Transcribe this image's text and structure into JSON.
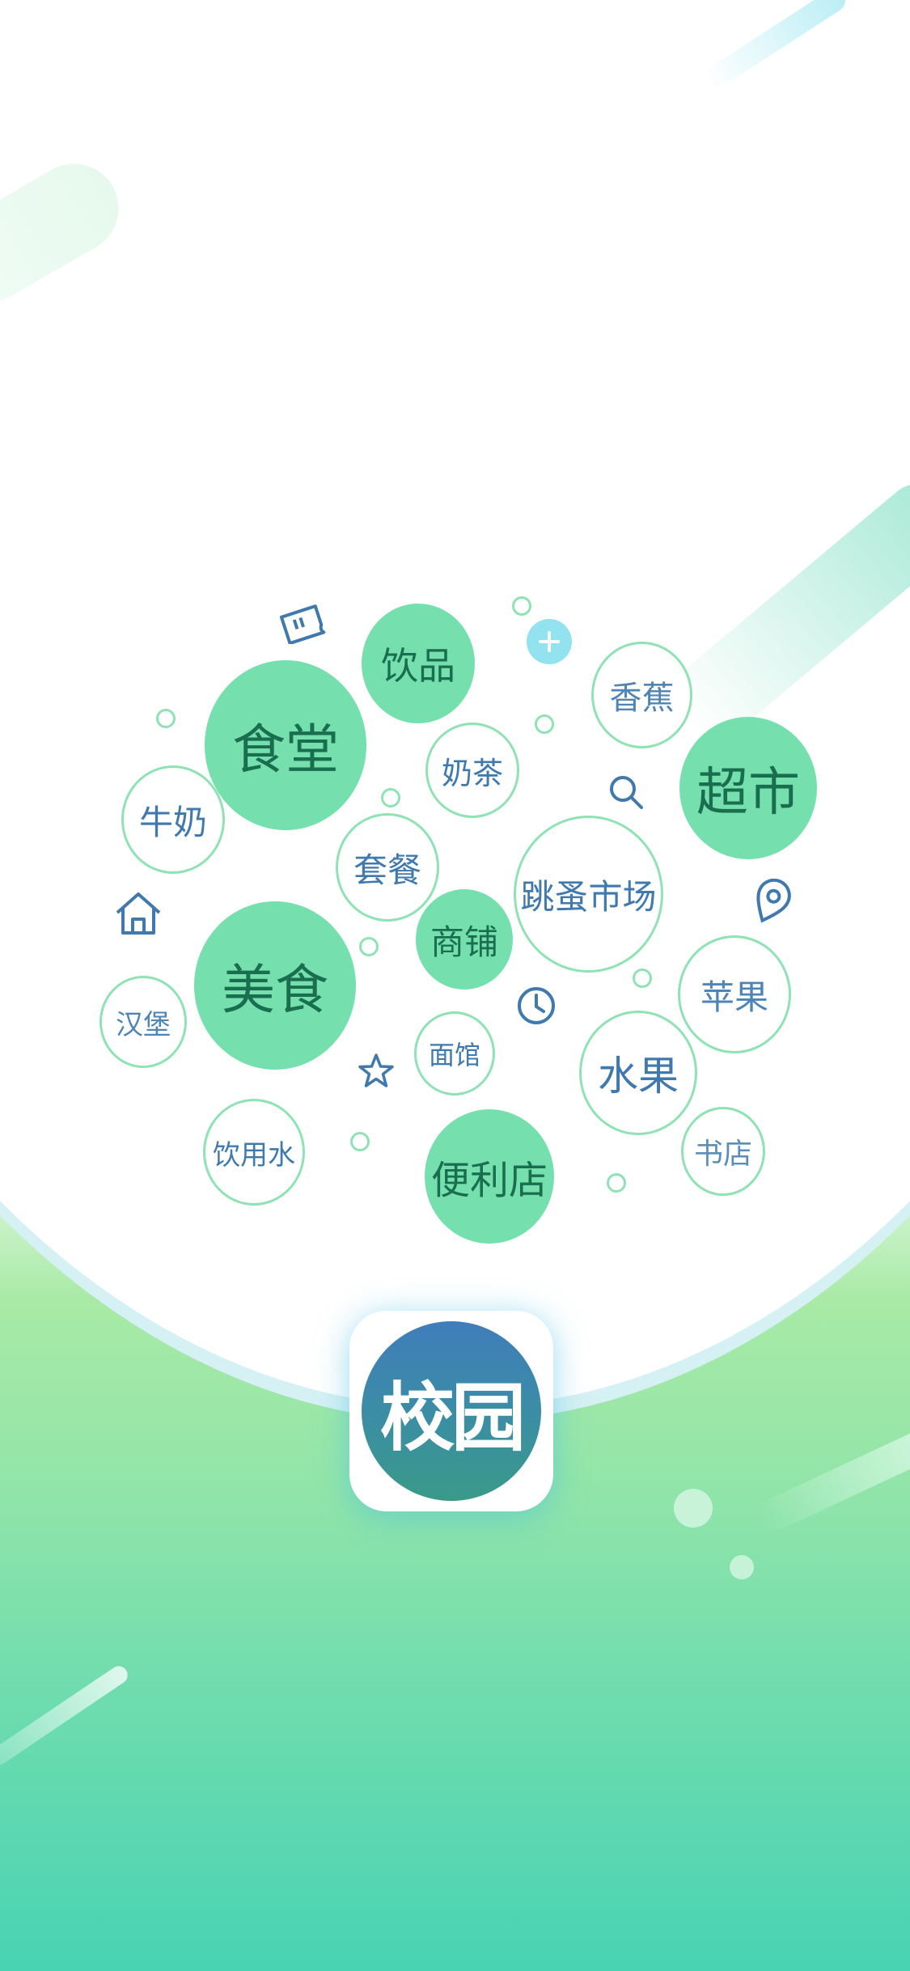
{
  "app": {
    "icon_label": "校园",
    "colors": {
      "accent_green": "#75dfad",
      "outline_green": "#8fe2b4",
      "text_blue": "#3f79ad",
      "text_dark_green": "#1a6e50",
      "icon_blue": "#3f7dbb",
      "bottom_teal": "#48d3b3"
    }
  },
  "tags": [
    {
      "label": "饮品"
    },
    {
      "label": "香蕉"
    },
    {
      "label": "食堂"
    },
    {
      "label": "奶茶"
    },
    {
      "label": "超市"
    },
    {
      "label": "牛奶"
    },
    {
      "label": "套餐"
    },
    {
      "label": "跳蚤市场"
    },
    {
      "label": "商铺"
    },
    {
      "label": "美食"
    },
    {
      "label": "苹果"
    },
    {
      "label": "汉堡"
    },
    {
      "label": "面馆"
    },
    {
      "label": "水果"
    },
    {
      "label": "饮用水"
    },
    {
      "label": "便利店"
    },
    {
      "label": "书店"
    }
  ],
  "icons": [
    "ticket-icon",
    "plus-icon",
    "search-icon",
    "home-icon",
    "location-icon",
    "clock-icon",
    "star-icon"
  ]
}
